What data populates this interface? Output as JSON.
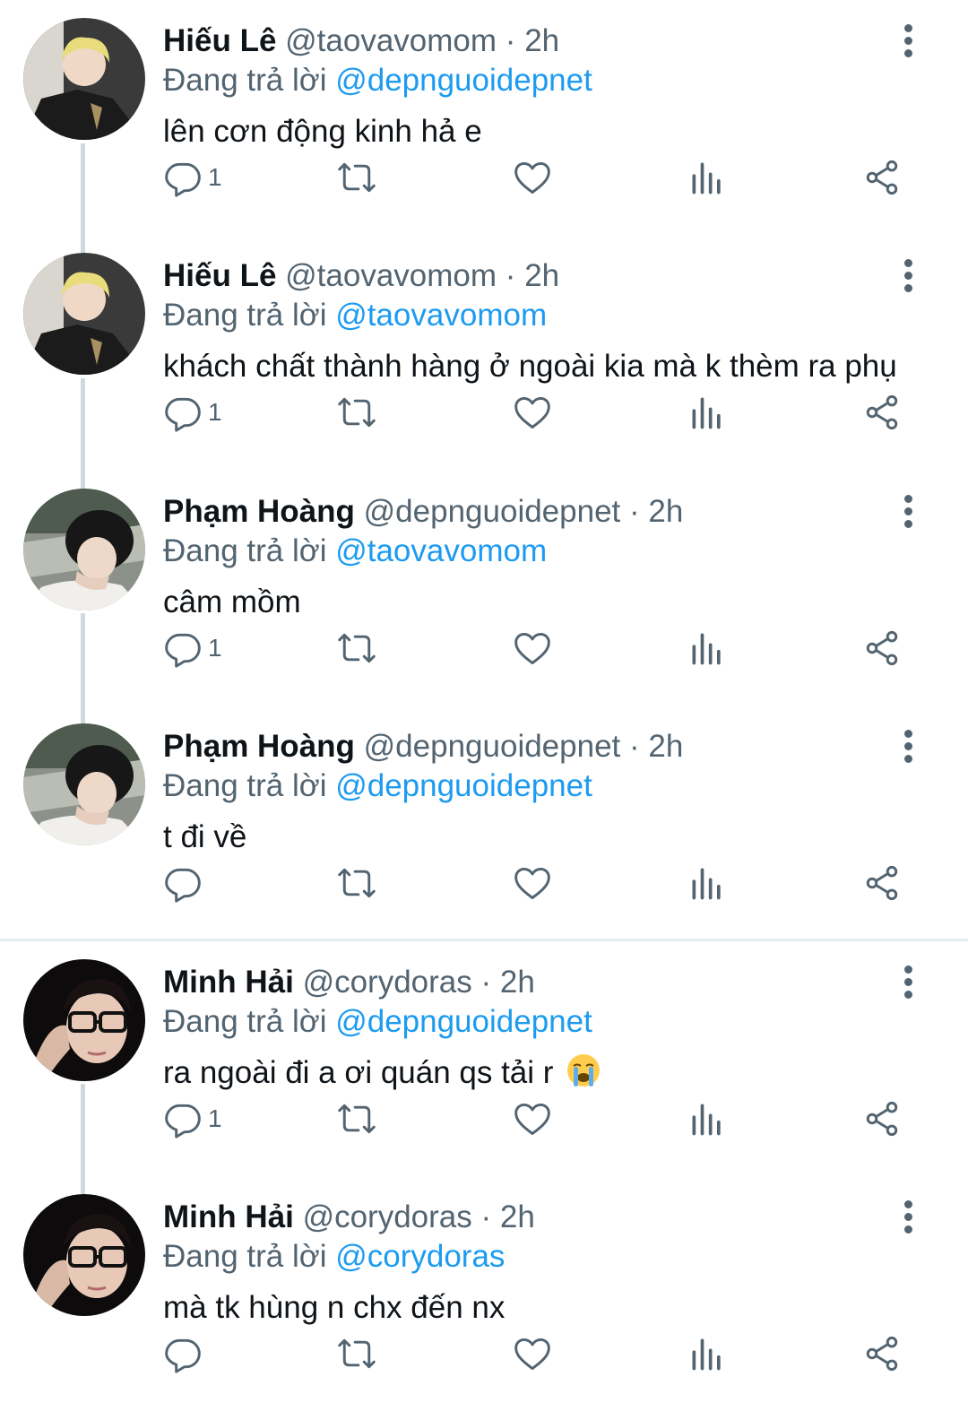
{
  "tweets": [
    {
      "name": "Hiếu Lê",
      "handle": "@taovavomom",
      "dot": "·",
      "time": "2h",
      "replying_prefix": "Đang trả lời",
      "replying_to": "@depnguoidepnet",
      "text": "lên cơn động kinh hả e",
      "reply_count": "1",
      "avatar": "hieu-le"
    },
    {
      "name": "Hiếu Lê",
      "handle": "@taovavomom",
      "dot": "·",
      "time": "2h",
      "replying_prefix": "Đang trả lời",
      "replying_to": "@taovavomom",
      "text": "khách chất thành hàng ở ngoài kia mà k thèm ra phụ",
      "reply_count": "1",
      "avatar": "hieu-le"
    },
    {
      "name": "Phạm Hoàng",
      "handle": "@depnguoidepnet",
      "dot": "·",
      "time": "2h",
      "replying_prefix": "Đang trả lời",
      "replying_to": "@taovavomom",
      "text": "câm mồm",
      "reply_count": "1",
      "avatar": "pham-hoang"
    },
    {
      "name": "Phạm Hoàng",
      "handle": "@depnguoidepnet",
      "dot": "·",
      "time": "2h",
      "replying_prefix": "Đang trả lời",
      "replying_to": "@depnguoidepnet",
      "text": "t đi về",
      "reply_count": "",
      "avatar": "pham-hoang"
    },
    {
      "name": "Minh Hải",
      "handle": "@corydoras",
      "dot": "·",
      "time": "2h",
      "replying_prefix": "Đang trả lời",
      "replying_to": "@depnguoidepnet",
      "text": "ra ngoài đi a ơi quán qs tải r",
      "emoji": "crying-face",
      "reply_count": "1",
      "avatar": "minh-hai"
    },
    {
      "name": "Minh Hải",
      "handle": "@corydoras",
      "dot": "·",
      "time": "2h",
      "replying_prefix": "Đang trả lời",
      "replying_to": "@corydoras",
      "text": "mà tk hùng n chx đến nx",
      "reply_count": "",
      "avatar": "minh-hai"
    }
  ],
  "colors": {
    "accent": "#1d9bf0",
    "muted": "#536471",
    "text": "#0f1419",
    "thread_line": "#cfd9de"
  },
  "icons": [
    "reply-icon",
    "retweet-icon",
    "like-icon",
    "views-icon",
    "share-icon",
    "more-icon"
  ]
}
